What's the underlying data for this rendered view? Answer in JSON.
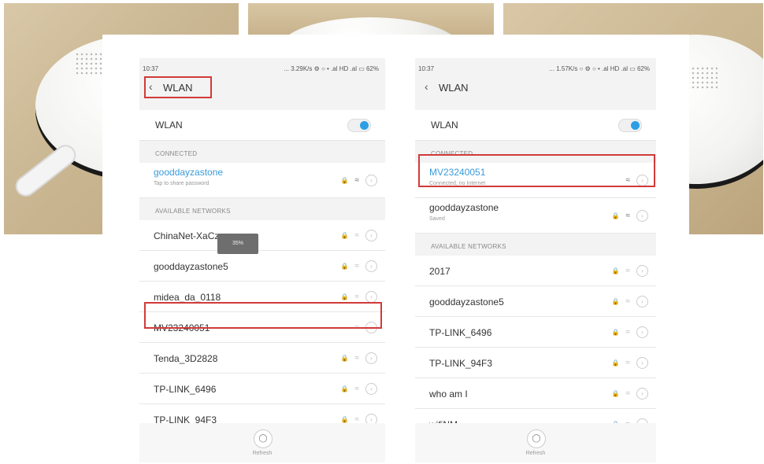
{
  "left_phone": {
    "status_time": "10:37",
    "status_right": "... 3.29K/s ⚙ ○ • .al HD .al ▭ 62%",
    "back_icon": "chevron-left-icon",
    "title": "WLAN",
    "wlan_toggle_label": "WLAN",
    "wlan_toggle_on": true,
    "connected_header": "CONNECTED",
    "connected": {
      "name": "gooddayzastone",
      "sub": "Tap to share password"
    },
    "available_header": "AVAILABLE NETWORKS",
    "available": [
      {
        "name": "ChinaNet-XaCz",
        "locked": true
      },
      {
        "name": "gooddayzastone5",
        "locked": true
      },
      {
        "name": "midea_da_0118",
        "locked": true
      },
      {
        "name": "MV23240051",
        "locked": false
      },
      {
        "name": "Tenda_3D2828",
        "locked": true
      },
      {
        "name": "TP-LINK_6496",
        "locked": true
      },
      {
        "name": "TP-LINK_94F3",
        "locked": true
      }
    ],
    "toast": "35%",
    "refresh_label": "Refresh"
  },
  "right_phone": {
    "status_time": "10:37",
    "status_right": "... 1.57K/s ○ ⚙ ○ • .al HD .al ▭ 62%",
    "title": "WLAN",
    "wlan_toggle_label": "WLAN",
    "wlan_toggle_on": true,
    "connected_header": "CONNECTED",
    "connected": [
      {
        "name": "MV23240051",
        "sub": "Connected, no Internet"
      },
      {
        "name": "gooddayzastone",
        "sub": "Saved"
      }
    ],
    "available_header": "AVAILABLE NETWORKS",
    "available": [
      {
        "name": "2017",
        "locked": true
      },
      {
        "name": "gooddayzastone5",
        "locked": true
      },
      {
        "name": "TP-LINK_6496",
        "locked": true
      },
      {
        "name": "TP-LINK_94F3",
        "locked": true
      },
      {
        "name": "who am I",
        "locked": true
      },
      {
        "name": "wifiNM",
        "locked": true
      }
    ],
    "refresh_label": "Refresh"
  },
  "colors": {
    "highlight": "#d23a3a",
    "toggle": "#2c9ee6",
    "connected_text": "#3a9ad9"
  }
}
